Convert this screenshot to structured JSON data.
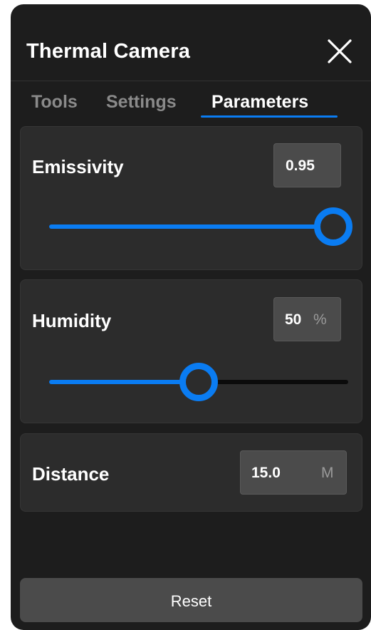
{
  "window": {
    "title": "Thermal Camera",
    "close_icon": "close-icon"
  },
  "tabs": [
    {
      "label": "Tools",
      "active": false
    },
    {
      "label": "Settings",
      "active": false
    },
    {
      "label": "Parameters",
      "active": true
    }
  ],
  "parameters": {
    "emissivity": {
      "label": "Emissivity",
      "value": "0.95",
      "slider_fraction": 0.95
    },
    "humidity": {
      "label": "Humidity",
      "value": "50",
      "unit": "%",
      "slider_fraction": 0.5
    },
    "distance": {
      "label": "Distance",
      "value": "15.0",
      "unit": "M"
    }
  },
  "reset_label": "Reset",
  "colors": {
    "accent": "#0a7cf2",
    "panel_background": "#1d1d1d",
    "card_background": "#2c2c2c"
  }
}
